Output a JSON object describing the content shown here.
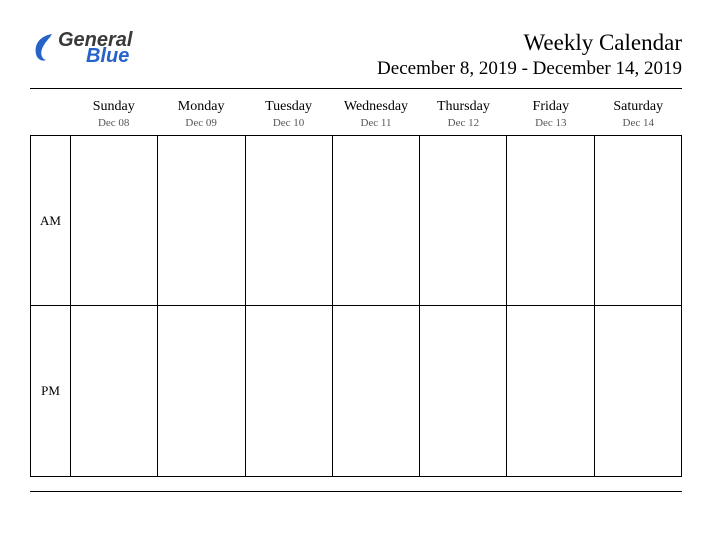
{
  "logo": {
    "text1": "General",
    "text2": "Blue",
    "accent_color": "#2563c9"
  },
  "header": {
    "title": "Weekly Calendar",
    "subtitle": "December 8, 2019 - December 14, 2019"
  },
  "days": [
    {
      "name": "Sunday",
      "date": "Dec 08"
    },
    {
      "name": "Monday",
      "date": "Dec 09"
    },
    {
      "name": "Tuesday",
      "date": "Dec 10"
    },
    {
      "name": "Wednesday",
      "date": "Dec 11"
    },
    {
      "name": "Thursday",
      "date": "Dec 12"
    },
    {
      "name": "Friday",
      "date": "Dec 13"
    },
    {
      "name": "Saturday",
      "date": "Dec 14"
    }
  ],
  "rows": [
    {
      "label": "AM"
    },
    {
      "label": "PM"
    }
  ]
}
